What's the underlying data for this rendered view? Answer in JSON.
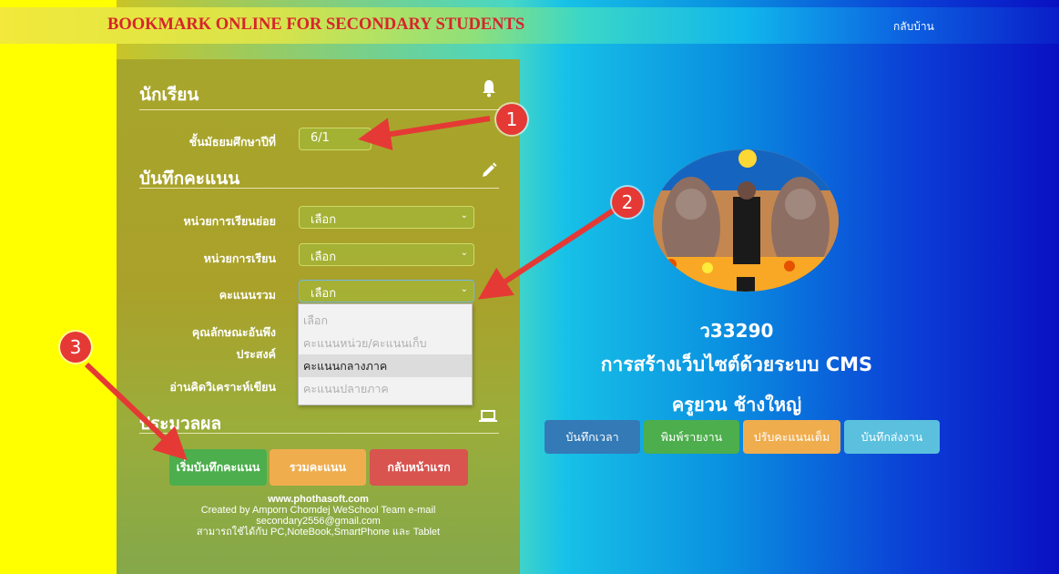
{
  "header": {
    "brand": "BOOKMARK ONLINE FOR SECONDARY STUDENTS",
    "home_link": "กลับบ้าน"
  },
  "panel": {
    "student_title": "นักเรียน",
    "grade_label": "ชั้นมัธยมศึกษาปีที่",
    "grade_value": "6/1",
    "record_title": "บันทึกคะแนน",
    "unit_sub_label": "หน่วยการเรียนย่อย",
    "unit_sub_value": "เลือก",
    "unit_label": "หน่วยการเรียน",
    "unit_value": "เลือก",
    "total_label": "คะแนนรวม",
    "total_value": "เลือก",
    "desirable_label_1": "คุณลักษณะอันพึง",
    "desirable_label_2": "ประสงค์",
    "reading_label": "อ่านคิดวิเคราะห์เขียน",
    "total_options": [
      "เลือก",
      "คะแนนหน่วย/คะแนนเก็บ",
      "คะแนนกลางภาค",
      "คะแนนปลายภาค"
    ],
    "total_selected_option": "คะแนนกลางภาค",
    "process_title": "ประมวลผล",
    "buttons": {
      "start": "เริ่มบันทึกคะแนน",
      "sum": "รวมคะแนน",
      "back": "กลับหน้าแรก"
    },
    "footer": {
      "site": "www.phothasoft.com",
      "line1": "Created by Amporn Chomdej WeSchool Team e-mail",
      "line2": "secondary2556@gmail.com",
      "line3": "สามารถใช้ได้กับ PC,NoteBook,SmartPhone และ Tablet"
    }
  },
  "course": {
    "code": "ว33290",
    "name": "การสร้างเว็บไซต์ด้วยระบบ CMS",
    "teacher": "ครูยวน ช้างใหญ่",
    "buttons": {
      "time": "บันทึกเวลา",
      "print": "พิมพ์รายงาน",
      "adjust": "ปรับคะแนนเต็ม",
      "submit": "บันทึกส่งงาน"
    }
  },
  "annotations": {
    "badge1": "1",
    "badge2": "2",
    "badge3": "3"
  },
  "colors": {
    "brand_red": "#d8242b",
    "btn_green": "#4cae4c",
    "btn_orange": "#f0ad4e",
    "btn_red": "#d9534f",
    "btn_blue": "#337ab7",
    "btn_cyan": "#5bc0de",
    "badge_red": "#e53935"
  },
  "icons": [
    "bell-icon",
    "pencil-icon",
    "laptop-icon",
    "chevron-down-icon"
  ]
}
